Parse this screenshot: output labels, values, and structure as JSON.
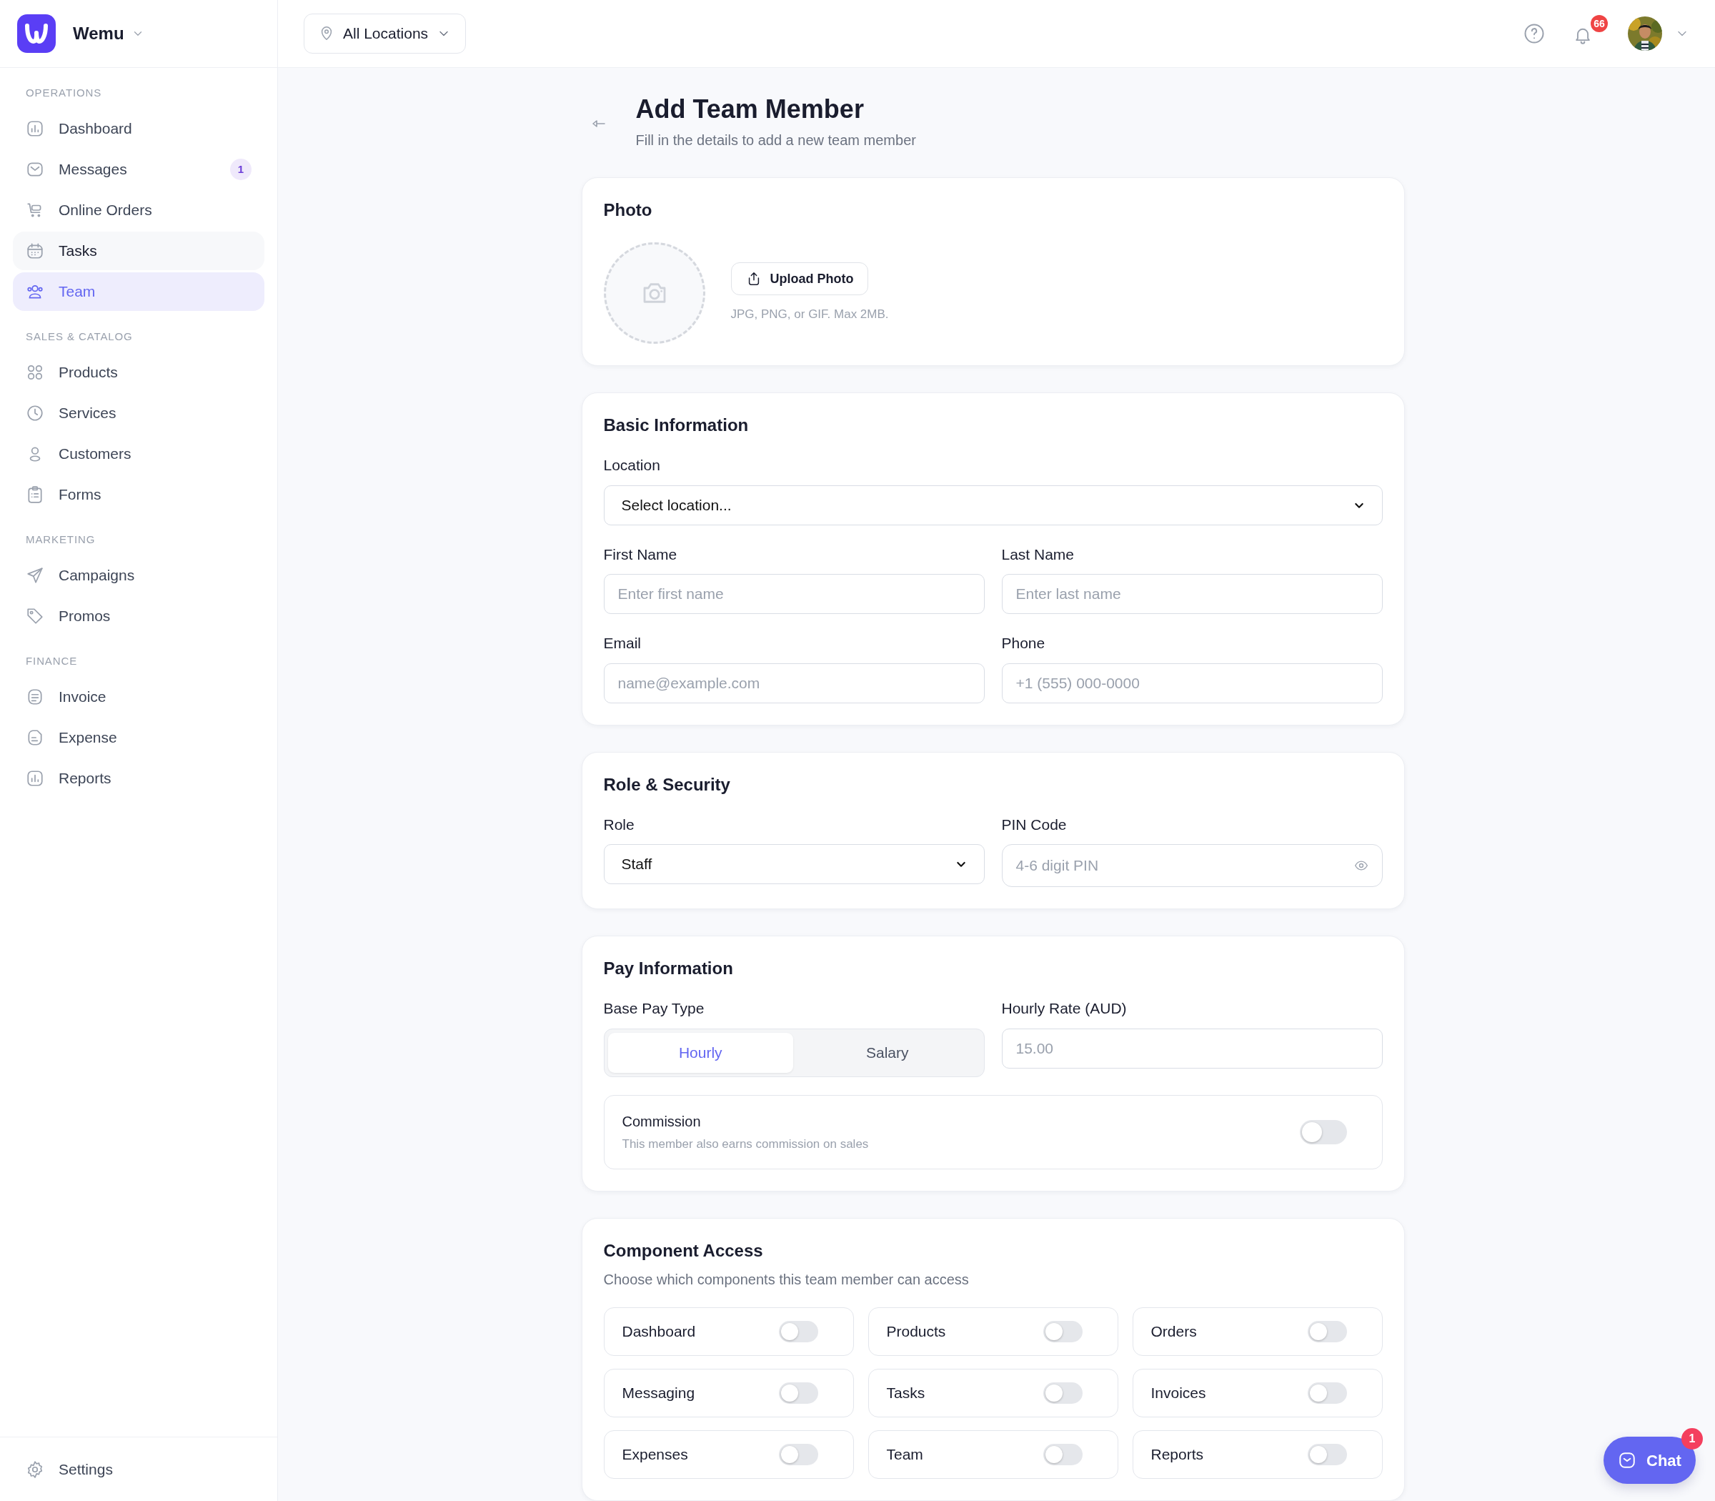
{
  "app": {
    "name": "Wemu"
  },
  "sidebar": {
    "sections": [
      {
        "title": "OPERATIONS",
        "items": [
          {
            "label": "Dashboard",
            "selected": false,
            "hovered": false
          },
          {
            "label": "Messages",
            "selected": false,
            "hovered": false,
            "badge": "1"
          },
          {
            "label": "Online Orders",
            "selected": false,
            "hovered": false
          },
          {
            "label": "Tasks",
            "selected": false,
            "hovered": true
          },
          {
            "label": "Team",
            "selected": true,
            "hovered": false
          }
        ]
      },
      {
        "title": "SALES & CATALOG",
        "items": [
          {
            "label": "Products",
            "selected": false,
            "hovered": false
          },
          {
            "label": "Services",
            "selected": false,
            "hovered": false
          },
          {
            "label": "Customers",
            "selected": false,
            "hovered": false
          },
          {
            "label": "Forms",
            "selected": false,
            "hovered": false
          }
        ]
      },
      {
        "title": "MARKETING",
        "items": [
          {
            "label": "Campaigns",
            "selected": false,
            "hovered": false
          },
          {
            "label": "Promos",
            "selected": false,
            "hovered": false
          }
        ]
      },
      {
        "title": "FINANCE",
        "items": [
          {
            "label": "Invoice",
            "selected": false,
            "hovered": false
          },
          {
            "label": "Expense",
            "selected": false,
            "hovered": false
          },
          {
            "label": "Reports",
            "selected": false,
            "hovered": false
          }
        ]
      }
    ],
    "settings": {
      "label": "Settings"
    }
  },
  "header": {
    "location_picker": "All Locations",
    "notifications_badge": "66"
  },
  "page": {
    "title": "Add Team Member",
    "subtitle": "Fill in the details to add a new team member"
  },
  "photo": {
    "title": "Photo",
    "button": "Upload Photo",
    "hint": "JPG, PNG, or GIF. Max 2MB."
  },
  "basic_information": {
    "title": "Basic Information",
    "location": {
      "label": "Location",
      "value": "Select location..."
    },
    "fields": [
      {
        "label": "First Name",
        "placeholder": "Enter first name"
      },
      {
        "label": "Last Name",
        "placeholder": "Enter last name"
      },
      {
        "label": "Email",
        "placeholder": "name@example.com"
      },
      {
        "label": "Phone",
        "placeholder": "+1 (555) 000-0000"
      }
    ]
  },
  "role_security": {
    "title": "Role & Security",
    "role": {
      "label": "Role",
      "value": "Staff"
    },
    "pin": {
      "label": "PIN Code",
      "placeholder": "4-6 digit PIN"
    }
  },
  "pay_information": {
    "title": "Pay Information",
    "base_pay_type": {
      "label": "Base Pay Type",
      "options": [
        {
          "label": "Hourly",
          "selected": true
        },
        {
          "label": "Salary",
          "selected": false
        }
      ]
    },
    "hourly_rate": {
      "label": "Hourly Rate (AUD)",
      "placeholder": "15.00"
    },
    "commission": {
      "title": "Commission",
      "description": "This member also earns commission on sales",
      "on": false
    }
  },
  "component_access": {
    "title": "Component Access",
    "subtitle": "Choose which components this team member can access",
    "items": [
      {
        "label": "Dashboard",
        "on": false
      },
      {
        "label": "Products",
        "on": false
      },
      {
        "label": "Orders",
        "on": false
      },
      {
        "label": "Messaging",
        "on": false
      },
      {
        "label": "Tasks",
        "on": false
      },
      {
        "label": "Invoices",
        "on": false
      },
      {
        "label": "Expenses",
        "on": false
      },
      {
        "label": "Team",
        "on": false
      },
      {
        "label": "Reports",
        "on": false
      }
    ]
  },
  "chat": {
    "label": "Chat",
    "badge": "1"
  }
}
